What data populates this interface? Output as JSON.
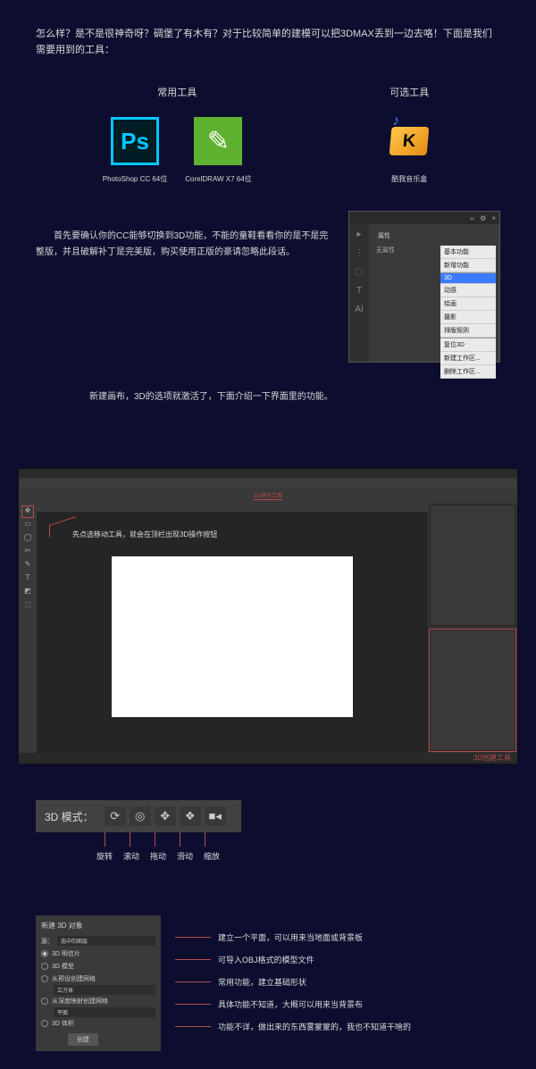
{
  "intro": "怎么样？是不是很神奇呀？碉堡了有木有？对于比较简单的建模可以把3DMAX丢到一边去咯！下面是我们需要用到的工具：",
  "tool_groups": {
    "common": {
      "title": "常用工具"
    },
    "optional": {
      "title": "可选工具"
    }
  },
  "tools": {
    "ps": {
      "glyph": "Ps",
      "label": "PhotoShop CC 64位"
    },
    "cdr": {
      "glyph": "✎",
      "label": "CorelDRAW X7 64位"
    },
    "kw": {
      "glyph": "K",
      "note": "♪",
      "label": "酷我音乐盒"
    }
  },
  "para1": "首先要确认你的CC能够切换到3D功能，不能的童鞋看看你的是不是完整版，并且破解补丁是完美版，购买使用正版的豪请忽略此段话。",
  "para2": "新建画布，3D的选项就激活了，下面介绍一下界面里的功能。",
  "panel": {
    "top_icons": [
      "‹‹",
      "⚙",
      "×"
    ],
    "left_icons": [
      "▸",
      "⋮",
      "⬚",
      "T",
      "Aǀ"
    ],
    "tab": "属性",
    "row": "无属性",
    "menu": {
      "items_a": [
        "基本功能",
        "新增功能"
      ],
      "hl": "3D",
      "items_b": [
        "动感",
        "绘画",
        "摄影",
        "排版规则"
      ],
      "items_c": [
        "复位3D",
        "新建工作区...",
        "删除工作区..."
      ]
    }
  },
  "psw": {
    "opt_label": "3D操作工具",
    "hint": "先点选移动工具，就会在顶栏出现3D操作按钮",
    "right_label": "3D创建工具"
  },
  "mode": {
    "label": "3D 模式：",
    "icons": [
      "⟳",
      "◎",
      "✥",
      "❖",
      "■◂"
    ],
    "labels": [
      "旋转",
      "滚动",
      "拖动",
      "滑动",
      "缩放"
    ]
  },
  "create": {
    "title": "新建 3D 对象",
    "src_label": "源：",
    "src_value": "选中的图层",
    "opts": [
      {
        "label": "3D 明信片",
        "sub": null
      },
      {
        "label": "3D 模型",
        "sub": null
      },
      {
        "label": "从预设创建网格",
        "sub": "立方体"
      },
      {
        "label": "从深度映射创建网格",
        "sub": "平面"
      },
      {
        "label": "3D 体积",
        "sub": null
      }
    ],
    "btn": "创建",
    "desc": [
      "建立一个平面，可以用来当地面或背景板",
      "可导入OBJ格式的模型文件",
      "常用功能，建立基础形状",
      "具体功能不知道，大概可以用来当背景布",
      "功能不详，做出来的东西雾蒙蒙的，我也不知道干啥的"
    ]
  }
}
